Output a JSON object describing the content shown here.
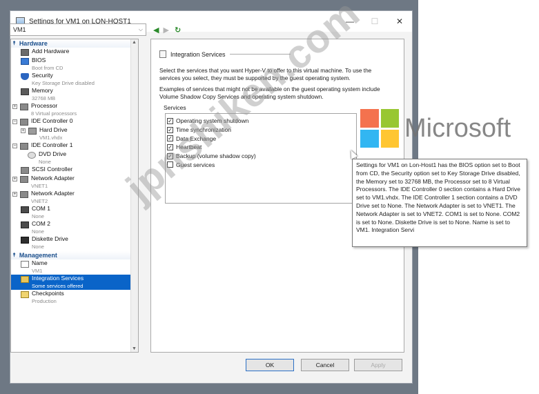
{
  "window": {
    "title": "Settings for VM1 on LON-HOST1",
    "minimize": "—",
    "maximize": "☐",
    "close": "✕"
  },
  "toolbar": {
    "vm_select_value": "VM1"
  },
  "tree": {
    "hardware_header": "Hardware",
    "management_header": "Management",
    "items": [
      {
        "label": "Add Hardware",
        "sub": ""
      },
      {
        "label": "BIOS",
        "sub": "Boot from CD"
      },
      {
        "label": "Security",
        "sub": "Key Storage Drive disabled"
      },
      {
        "label": "Memory",
        "sub": "32768 MB"
      },
      {
        "label": "Processor",
        "sub": "8 Virtual processors"
      },
      {
        "label": "IDE Controller 0",
        "sub": ""
      },
      {
        "label": "Hard Drive",
        "sub": "VM1.vhdx"
      },
      {
        "label": "IDE Controller 1",
        "sub": ""
      },
      {
        "label": "DVD Drive",
        "sub": "None"
      },
      {
        "label": "SCSI Controller",
        "sub": ""
      },
      {
        "label": "Network Adapter",
        "sub": "VNET1"
      },
      {
        "label": "Network Adapter",
        "sub": "VNET2"
      },
      {
        "label": "COM 1",
        "sub": "None"
      },
      {
        "label": "COM 2",
        "sub": "None"
      },
      {
        "label": "Diskette Drive",
        "sub": "None"
      }
    ],
    "mgmt_items": [
      {
        "label": "Name",
        "sub": "VM1"
      },
      {
        "label": "Integration Services",
        "sub": "Some services offered"
      },
      {
        "label": "Checkpoints",
        "sub": "Production"
      }
    ]
  },
  "pane": {
    "title": "Integration Services",
    "desc1": "Select the services that you want Hyper-V to offer to this virtual machine. To use the services you select, they must be supported by the guest operating system.",
    "desc2": "Examples of services that might not be available on the guest operating system include Volume Shadow Copy Services and operating system shutdown.",
    "group_label": "Services",
    "services": [
      {
        "label": "Operating system shutdown",
        "checked": "✓"
      },
      {
        "label": "Time synchronization",
        "checked": "✓"
      },
      {
        "label": "Data Exchange",
        "checked": "✓"
      },
      {
        "label": "Heartbeat",
        "checked": "✓"
      },
      {
        "label": "Backup (volume shadow copy)",
        "checked": "✓"
      },
      {
        "label": "Guest services",
        "checked": ""
      }
    ]
  },
  "buttons": {
    "ok": "OK",
    "cancel": "Cancel",
    "apply": "Apply"
  },
  "tooltip": {
    "text": "Settings for VM1 on Lon-Host1 has the BIOS option set to Boot from CD, the Security option set to Key Storage Drive disabled, the Memory set to 32768 MB, the Processor set to 8 Virtual Processors. The IDE Controller 0 section contains a Hard Drive set to VM1.vhdx. The IDE Controller 1 section contains a DVD Drive set to None. The Network Adapter is set to VNET1. The Network Adapter is set to VNET2. COM1 is set to None. COM2 is set to None. Diskette Drive is set to None. Name is set to VM1. Integration Servi"
  },
  "overlay": {
    "microsoft_word": "Microsoft",
    "watermark": "jpnshiken.com"
  },
  "colors": {
    "accent": "#0a64c8",
    "section_header": "#1b4f8c"
  }
}
